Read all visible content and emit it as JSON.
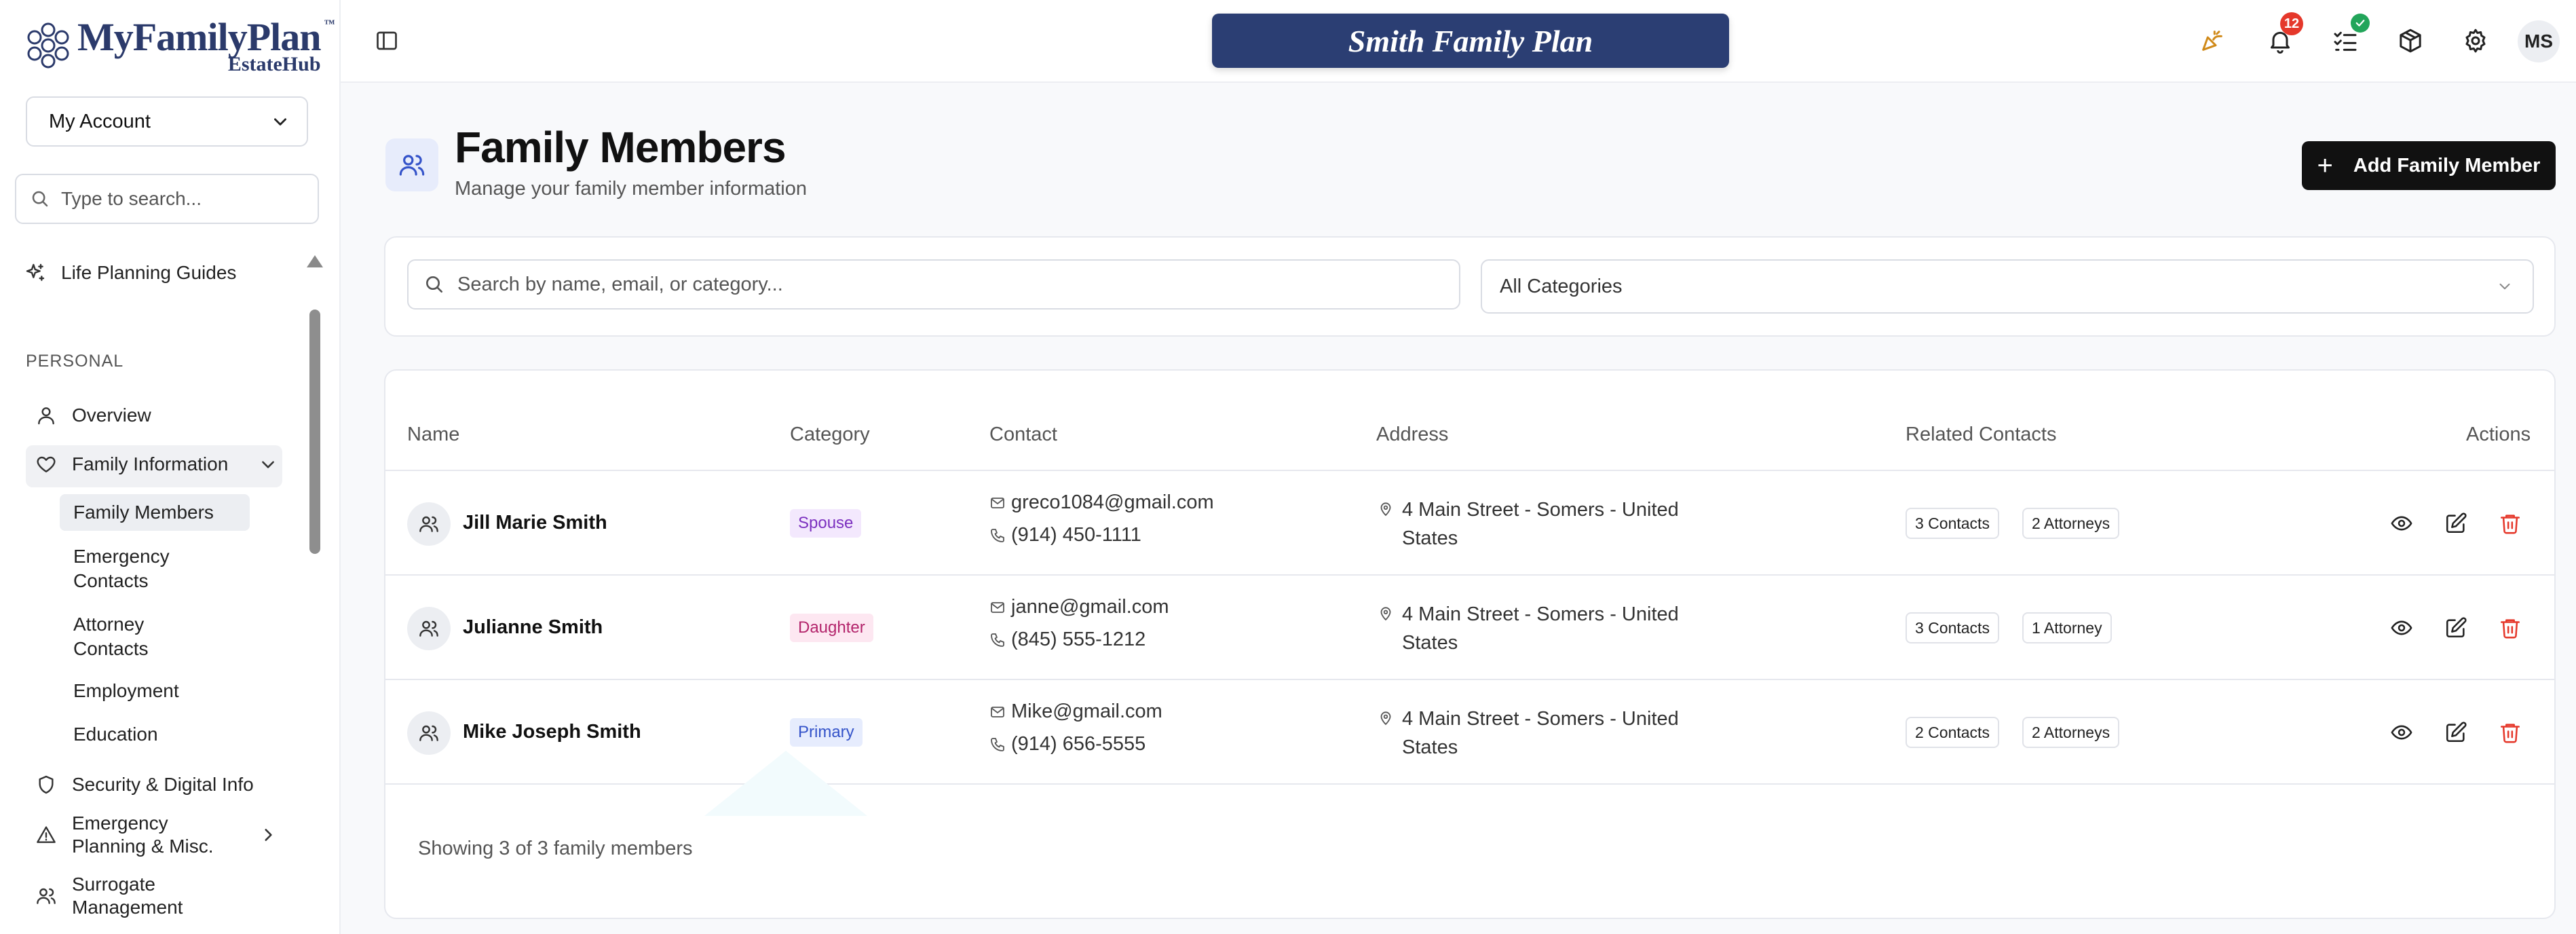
{
  "logo": {
    "name": "MyFamilyPlan",
    "tm": "™",
    "sub": "EstateHub"
  },
  "account": {
    "selected": "My Account"
  },
  "sidebar_search": {
    "placeholder": "Type to search..."
  },
  "nav": {
    "life_planning_guides": "Life Planning Guides",
    "section_personal": "PERSONAL",
    "overview": "Overview",
    "family_information": "Family Information",
    "sub": {
      "family_members": "Family Members",
      "emergency_contacts": "Emergency Contacts",
      "attorney_contacts": "Attorney Contacts",
      "employment": "Employment",
      "education": "Education"
    },
    "security_digital": "Security & Digital Info",
    "emergency_planning": "Emergency Planning & Misc.",
    "surrogate_management": "Surrogate Management"
  },
  "topbar": {
    "plan_title": "Smith Family Plan",
    "notification_count": "12",
    "avatar_initials": "MS"
  },
  "page": {
    "title": "Family Members",
    "subtitle": "Manage your family member information",
    "add_button": "Add Family Member",
    "add_icon": "+"
  },
  "filters": {
    "search_placeholder": "Search by name, email, or category...",
    "category_selected": "All Categories"
  },
  "table": {
    "headers": {
      "name": "Name",
      "category": "Category",
      "contact": "Contact",
      "address": "Address",
      "related": "Related Contacts",
      "actions": "Actions"
    },
    "rows": [
      {
        "name": "Jill Marie Smith",
        "category": "Spouse",
        "email": "greco1084@gmail.com",
        "phone": "(914) 450-1111",
        "address": "4 Main Street - Somers - United States",
        "contacts": "3 Contacts",
        "attorneys": "2 Attorneys"
      },
      {
        "name": "Julianne Smith",
        "category": "Daughter",
        "email": "janne@gmail.com",
        "phone": "(845) 555-1212",
        "address": "4 Main Street - Somers - United States",
        "contacts": "3 Contacts",
        "attorneys": "1 Attorney"
      },
      {
        "name": "Mike Joseph Smith",
        "category": "Primary",
        "email": "Mike@gmail.com",
        "phone": "(914) 656-5555",
        "address": "4 Main Street - Somers - United States",
        "contacts": "2 Contacts",
        "attorneys": "2 Attorneys"
      }
    ],
    "footer": "Showing 3 of 3 family members"
  },
  "colors": {
    "banner": "#2b3e73",
    "spouse_badge_bg": "#f3e8fd",
    "spouse_badge_fg": "#7b2fbf",
    "daughter_badge_bg": "#fde7f1",
    "daughter_badge_fg": "#b3246b",
    "primary_badge_bg": "#e6ecfd",
    "primary_badge_fg": "#3453c9",
    "delete": "#e5382b",
    "notification_badge": "#e5382b",
    "success_badge": "#22a55a"
  },
  "icons": {
    "logo": "network-logo-icon",
    "toggle": "sidebar-toggle-icon",
    "celebrate": "party-popper-icon",
    "bell": "bell-icon",
    "tasks": "list-checks-icon",
    "box": "package-icon",
    "settings": "gear-icon",
    "family": "users-icon",
    "view": "eye-icon",
    "edit": "edit-icon",
    "delete": "trash-icon"
  }
}
